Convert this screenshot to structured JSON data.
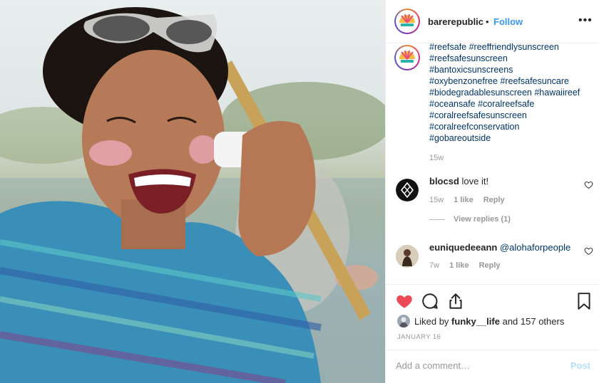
{
  "post": {
    "username": "barerepublic",
    "separator": "•",
    "follow_label": "Follow",
    "more_label": "•••"
  },
  "caption": {
    "lines": [
      "#reefsafe #reeffriendlysunscreen",
      "#reefsafesunscreen",
      "#bantoxicsunscreens",
      "#oxybenzonefree #reefsafesuncare",
      "#biodegradablesunscreen #hawaiireef",
      "#oceansafe #coralreefsafe",
      "#coralreefsafesunscreen",
      "#coralreefconservation",
      "#gobareoutside"
    ],
    "time": "15w"
  },
  "comments": [
    {
      "username": "blocsd",
      "text": "love it!",
      "time": "15w",
      "likes": "1 like",
      "reply_label": "Reply",
      "view_replies": "View replies (1)"
    },
    {
      "username": "euniquedeeann",
      "mention": "@alohaforpeople",
      "time": "7w",
      "likes": "1 like",
      "reply_label": "Reply"
    }
  ],
  "likes": {
    "text_prefix": "Liked by",
    "liker": "funky__life",
    "text_suffix": "and 157 others"
  },
  "date": "JANUARY 16",
  "add_comment": {
    "placeholder": "Add a comment…",
    "post_label": "Post"
  },
  "colors": {
    "link": "#3897f0",
    "hashtag": "#003569",
    "heart": "#ed4956",
    "muted": "#999999",
    "post_disabled": "#b2dffc"
  },
  "icons": {
    "like": "heart-filled-icon",
    "comment": "speech-bubble-icon",
    "share": "share-upload-icon",
    "save": "bookmark-icon",
    "comment_like": "heart-outline-icon"
  }
}
